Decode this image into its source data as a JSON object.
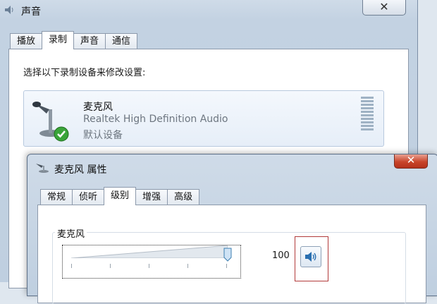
{
  "sound_window": {
    "title": "声音",
    "close_label": "✕",
    "tabs": [
      {
        "label": "播放"
      },
      {
        "label": "录制",
        "active": true
      },
      {
        "label": "声音"
      },
      {
        "label": "通信"
      }
    ],
    "instruction": "选择以下录制设备来修改设置:",
    "device": {
      "name": "麦克风",
      "description": "Realtek High Definition Audio",
      "status": "默认设备"
    }
  },
  "properties_dialog": {
    "title": "麦克风 属性",
    "close_label": "✕",
    "tabs": [
      {
        "label": "常规"
      },
      {
        "label": "侦听"
      },
      {
        "label": "级别",
        "active": true
      },
      {
        "label": "增强"
      },
      {
        "label": "高级"
      }
    ],
    "levels": {
      "group_label": "麦克风",
      "slider_value": 100,
      "value_text": "100",
      "mute_icon": "speaker-icon"
    }
  },
  "colors": {
    "highlight_border": "#b23a3a",
    "close_button_red": "#c8442a"
  }
}
